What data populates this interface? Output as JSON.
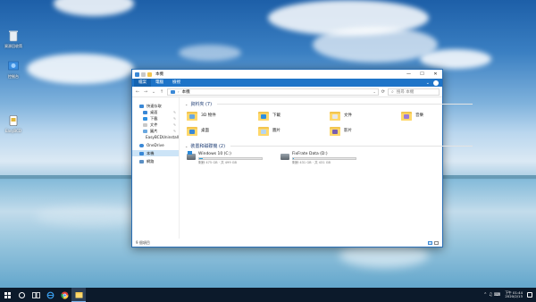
{
  "desktop": {
    "icons": [
      {
        "label": "資源回收筒"
      },
      {
        "label": "控制台"
      },
      {
        "label": "EasyBCD"
      }
    ]
  },
  "window": {
    "title": "本機",
    "controls": {
      "minimize": "—",
      "maximize": "☐",
      "close": "✕"
    },
    "ribbon_tabs": [
      "檔案",
      "電腦",
      "檢視"
    ],
    "ribbon_help": "?",
    "nav": {
      "back": "←",
      "forward": "→",
      "up": "↑",
      "recent": "⌄"
    },
    "address": {
      "crumb": "本機",
      "dropdown": "⌄"
    },
    "search": {
      "placeholder": "搜尋 本機"
    },
    "sidebar": {
      "items": [
        {
          "label": "快速存取",
          "pinned": false
        },
        {
          "label": "桌面",
          "pinned": true
        },
        {
          "label": "下載",
          "pinned": true
        },
        {
          "label": "文件",
          "pinned": true
        },
        {
          "label": "圖片",
          "pinned": true
        },
        {
          "label": "EasyBCDUninstall",
          "pinned": false
        },
        {
          "label": "OneDrive",
          "pinned": false
        },
        {
          "label": "本機",
          "pinned": false
        },
        {
          "label": "網路",
          "pinned": false
        }
      ]
    },
    "folders_group": {
      "title": "資料夾 (7)"
    },
    "folders": [
      {
        "name": "3D 物件",
        "badge": "#6aa8e0"
      },
      {
        "name": "下載",
        "badge": "#2d8fe0"
      },
      {
        "name": "文件",
        "badge": "#e8e8e8"
      },
      {
        "name": "音樂",
        "badge": "#9b7bd8"
      },
      {
        "name": "桌面",
        "badge": "#3a88d6"
      },
      {
        "name": "圖片",
        "badge": "#b5d5f0"
      },
      {
        "name": "影片",
        "badge": "#7a5fb0"
      }
    ],
    "drives_group": {
      "title": "裝置和磁碟機 (2)"
    },
    "drives": [
      {
        "name": "Windows 10 (C:)",
        "free": "剩餘 475 GB · 共 499 GB",
        "used_fraction": 0.05
      },
      {
        "name": "FixFrate Data (D:)",
        "free": "剩餘 431 GB · 共 431 GB",
        "used_fraction": 0.01
      }
    ],
    "status": {
      "items": "9 個項目"
    }
  },
  "taskbar": {
    "buttons": [
      "開始",
      "搜尋",
      "工作檢視",
      "Internet Explorer",
      "Google Chrome",
      "檔案總管"
    ],
    "tray": {
      "symbols": "⌃ ♫ ⌨",
      "time": "下午 01:44",
      "date": "2020/2/13"
    }
  },
  "colors": {
    "accent": "#1e74c8",
    "folder": "#ffd86b",
    "taskbar": "#0c1a2b",
    "selection": "#cce4f7"
  }
}
